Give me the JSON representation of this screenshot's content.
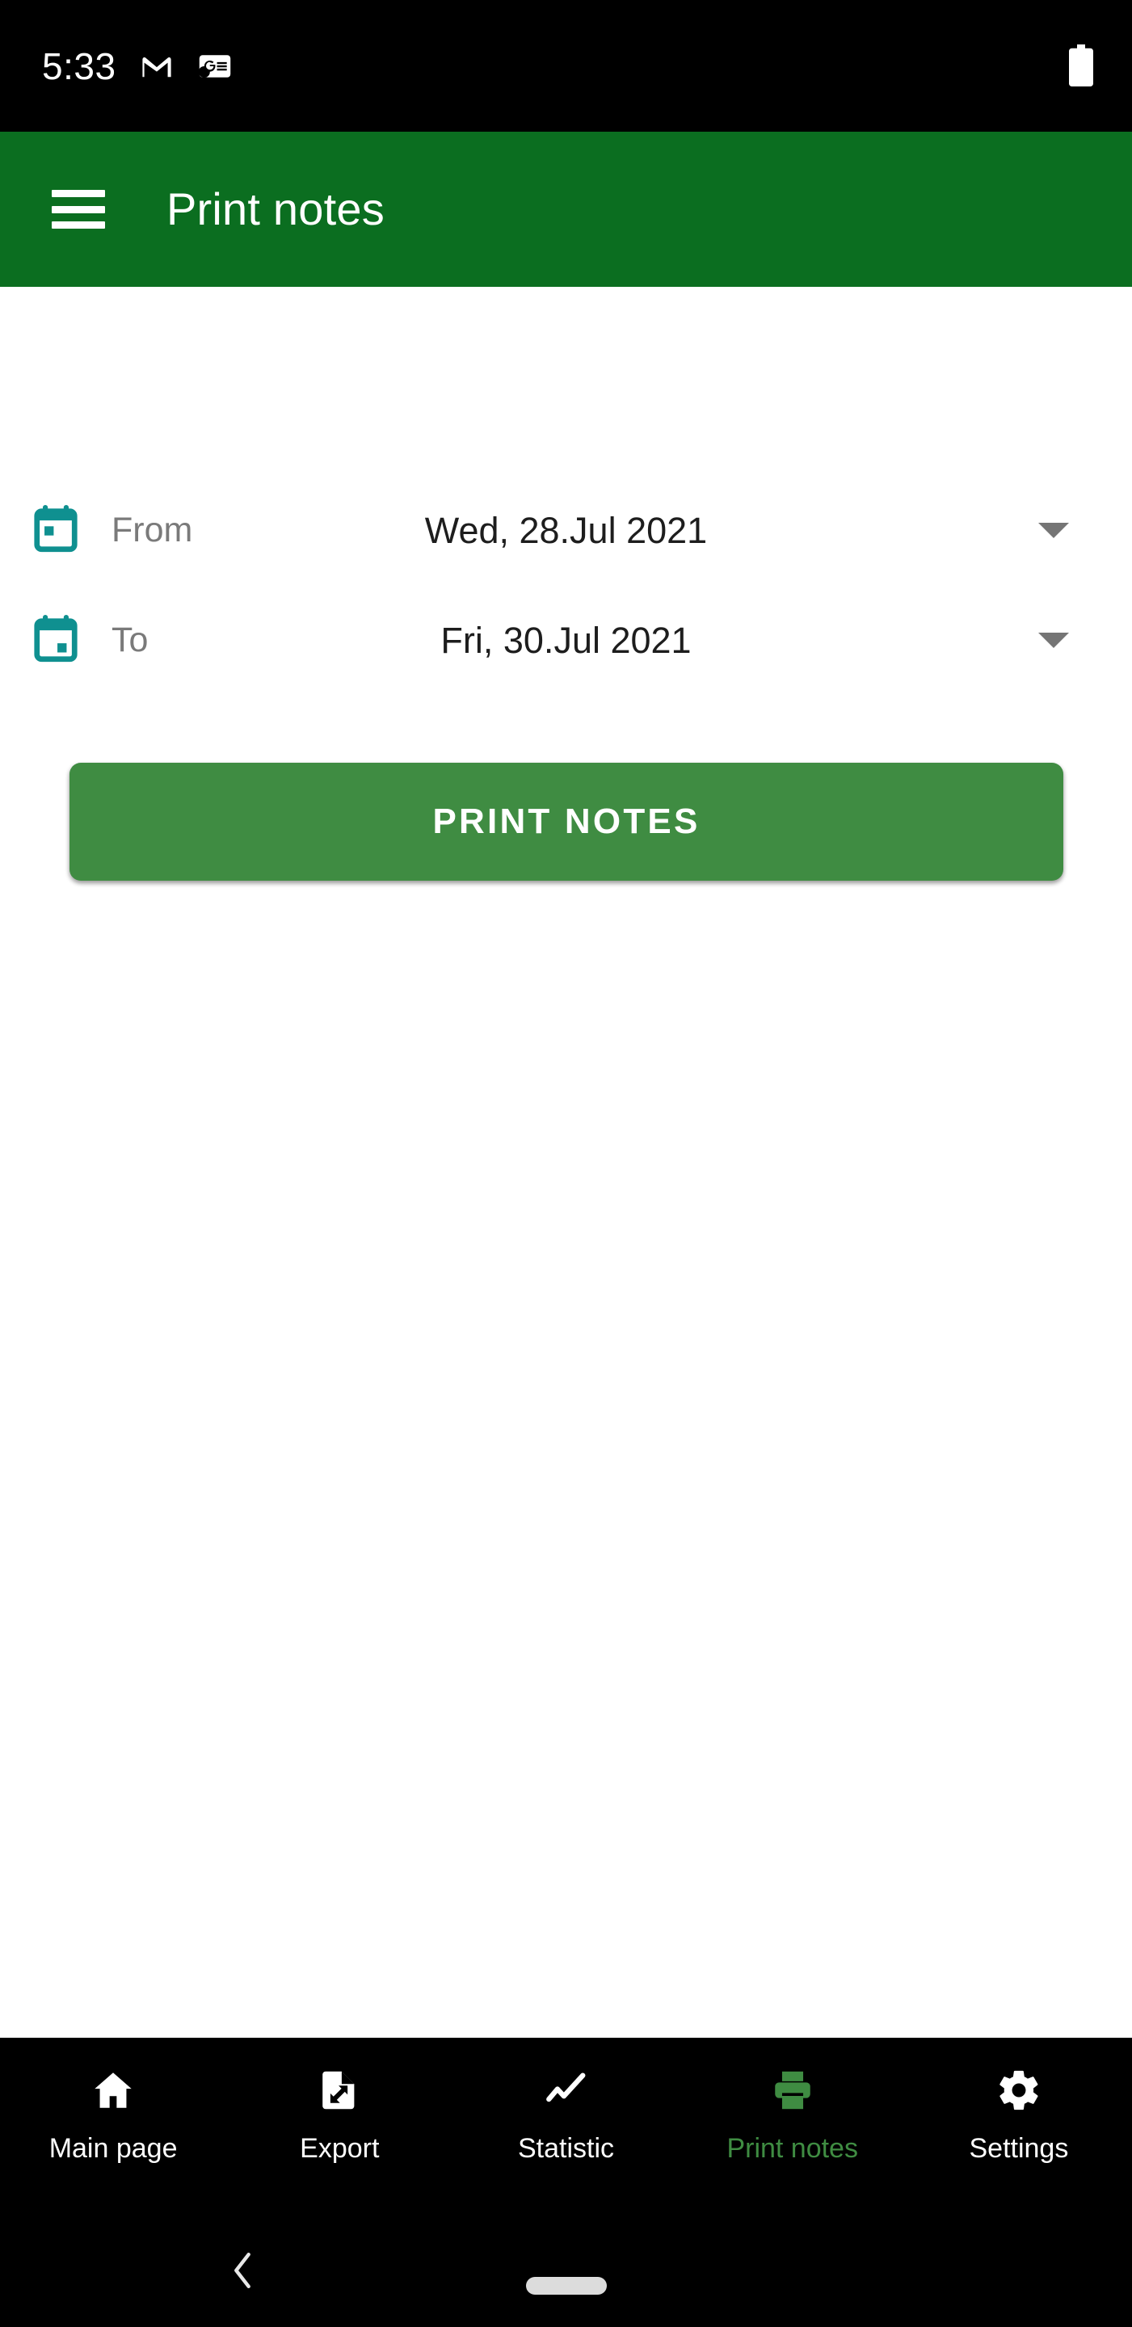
{
  "status_bar": {
    "time": "5:33",
    "icons": [
      "gmail-icon",
      "google-news-icon"
    ],
    "battery": "battery-full-icon",
    "background": "#000000"
  },
  "app_bar": {
    "menu_icon": "hamburger-menu-icon",
    "title": "Print notes",
    "background": "#0b6e20",
    "text_color": "#ffffff"
  },
  "form": {
    "accent_calendar_color": "#0f9090",
    "rows": [
      {
        "icon": "calendar-icon",
        "label": "From",
        "value": "Wed, 28.Jul 2021",
        "caret": "chevron-down-icon"
      },
      {
        "icon": "calendar-icon",
        "label": "To",
        "value": "Fri, 30.Jul 2021",
        "caret": "chevron-down-icon"
      }
    ]
  },
  "primary_action": {
    "label": "PRINT NOTES",
    "background": "#3f8c42",
    "text_color": "#ffffff"
  },
  "bottom_nav": {
    "background": "#000000",
    "active_color": "#3f8c42",
    "inactive_color": "#ffffff",
    "items": [
      {
        "label": "Main page",
        "icon": "home-icon",
        "active": false
      },
      {
        "label": "Export",
        "icon": "file-export-icon",
        "active": false
      },
      {
        "label": "Statistic",
        "icon": "line-chart-icon",
        "active": false
      },
      {
        "label": "Print notes",
        "icon": "printer-icon",
        "active": true
      },
      {
        "label": "Settings",
        "icon": "gear-icon",
        "active": false
      }
    ]
  },
  "system_nav": {
    "back": "back-chevron-icon",
    "home": "home-pill-indicator"
  }
}
